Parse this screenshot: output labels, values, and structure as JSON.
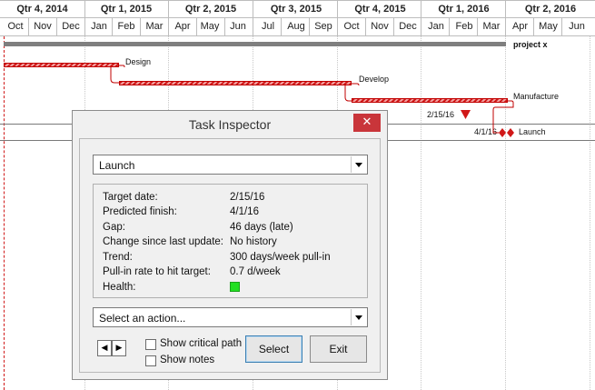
{
  "timeline": {
    "quarters": [
      "Qtr 4, 2014",
      "Qtr 1, 2015",
      "Qtr 2, 2015",
      "Qtr 3, 2015",
      "Qtr 4, 2015",
      "Qtr 1, 2016",
      "Qtr 2, 2016"
    ],
    "months": [
      "Oct",
      "Nov",
      "Dec",
      "Jan",
      "Feb",
      "Mar",
      "Apr",
      "May",
      "Jun",
      "Jul",
      "Aug",
      "Sep",
      "Oct",
      "Nov",
      "Dec",
      "Jan",
      "Feb",
      "Mar",
      "Apr",
      "May",
      "Jun"
    ]
  },
  "gantt": {
    "summary_label": "project x",
    "tasks": [
      {
        "label": "Design"
      },
      {
        "label": "Develop"
      },
      {
        "label": "Manufacture"
      },
      {
        "label": "Launch"
      }
    ],
    "target_marker_label": "2/15/16",
    "predicted_marker_label": "4/1/16",
    "colors": {
      "bar": "#d01818",
      "summary": "#7f7f7f",
      "today_line": "#d01818"
    }
  },
  "dialog": {
    "title": "Task Inspector",
    "close_icon": "close-icon",
    "task_select": {
      "selected": "Launch"
    },
    "fields": [
      {
        "label": "Target date:",
        "value": "2/15/16"
      },
      {
        "label": "Predicted finish:",
        "value": "4/1/16"
      },
      {
        "label": "Gap:",
        "value": "46 days (late)"
      },
      {
        "label": "Change since last update:",
        "value": "No history"
      },
      {
        "label": "Trend:",
        "value": "300 days/week pull-in"
      },
      {
        "label": "Pull-in rate to hit target:",
        "value": "0.7 d/week"
      },
      {
        "label": "Health:",
        "value_color": "#22e022"
      }
    ],
    "action_select": {
      "selected": "Select an action..."
    },
    "show_critical_path": {
      "label": "Show critical path",
      "checked": false
    },
    "show_notes": {
      "label": "Show notes",
      "checked": false
    },
    "prev_icon": "triangle-left-icon",
    "next_icon": "triangle-right-icon",
    "select_button": "Select",
    "exit_button": "Exit"
  }
}
